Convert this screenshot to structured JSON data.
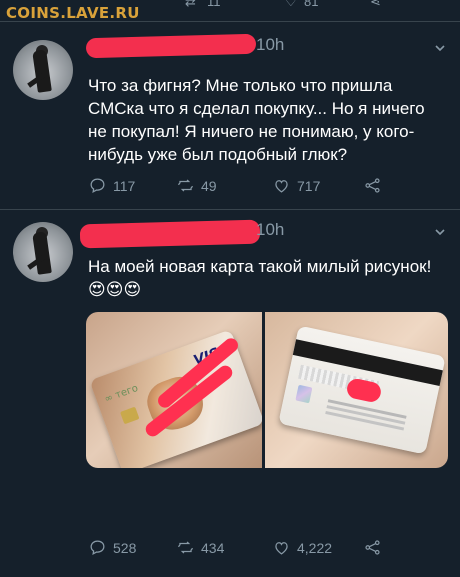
{
  "watermark": "COINS.LAVE.RU",
  "top_actions": {
    "retweets": "11",
    "likes": "81"
  },
  "tweets": [
    {
      "time": "10h",
      "text": "Что за фигня? Мне только что пришла СМСка что я сделал покупку... Но я ничего не покупал! Я ничего не понимаю, у кого-нибудь уже был подобный глюк?",
      "replies": "117",
      "retweets": "49",
      "likes": "717"
    },
    {
      "time": "10h",
      "text": "На моей новая карта такой милый рисунок! 😍😍😍",
      "replies": "528",
      "retweets": "434",
      "likes": "4,222",
      "card_brand": "VISA"
    }
  ],
  "colors": {
    "background": "#15202b",
    "muted": "#8899a6",
    "redaction": "#ff3050",
    "divider": "#38444d"
  },
  "icons": [
    "reply-icon",
    "retweet-icon",
    "like-icon",
    "share-icon",
    "chevron-down-icon"
  ]
}
